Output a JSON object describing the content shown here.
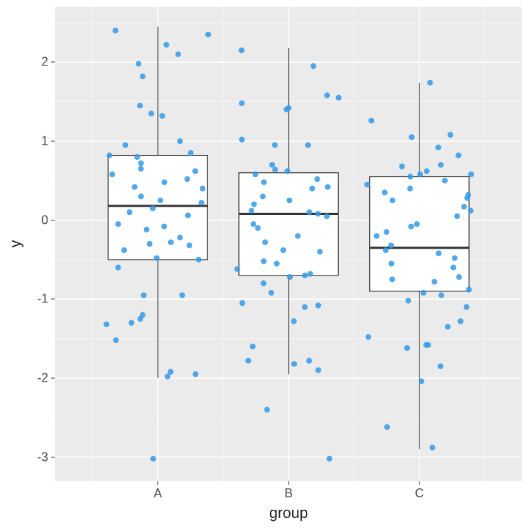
{
  "chart_data": {
    "type": "box-jitter",
    "xlabel": "group",
    "ylabel": "y",
    "categories": [
      "A",
      "B",
      "C"
    ],
    "ylim": [
      -3.3,
      2.7
    ],
    "y_ticks": [
      -3,
      -2,
      -1,
      0,
      1,
      2
    ],
    "point_color": "#3399E6",
    "panel_bg": "#EBEBEB",
    "series": [
      {
        "name": "A",
        "box": {
          "lower_whisker": -2.0,
          "q1": -0.5,
          "median": 0.18,
          "q3": 0.82,
          "upper_whisker": 2.45
        },
        "points": [
          1.82,
          1.45,
          -1.25,
          -1.98,
          -1.95,
          2.22,
          1.32,
          -0.95,
          -1.52,
          -1.92,
          0.72,
          -1.32,
          0.06,
          -0.05,
          -0.5,
          0.85,
          0.4,
          0.22,
          0.58,
          -0.28,
          0.95,
          2.4,
          1.35,
          0.82,
          -0.08,
          1.98,
          0.48,
          0.62,
          0.1,
          -0.12,
          -0.48,
          -0.32,
          -0.95,
          -0.6,
          0.25,
          0.15,
          0.3,
          -1.2,
          -1.3,
          -3.02,
          2.1,
          0.65,
          0.52,
          2.35,
          1.0,
          0.42,
          0.8,
          -0.3,
          -0.22,
          -0.38
        ]
      },
      {
        "name": "B",
        "box": {
          "lower_whisker": -1.95,
          "q1": -0.7,
          "median": 0.08,
          "q3": 0.6,
          "upper_whisker": 2.18
        },
        "points": [
          1.55,
          0.95,
          -0.62,
          -1.08,
          -1.28,
          1.95,
          1.02,
          -0.28,
          -0.72,
          0.58,
          0.3,
          0.48,
          -0.1,
          -0.7,
          0.1,
          -3.02,
          1.48,
          0.64,
          0.25,
          -0.05,
          -0.52,
          -0.8,
          -1.1,
          0.4,
          0.08,
          0.95,
          2.15,
          1.58,
          1.42,
          0.62,
          0.05,
          -0.4,
          -0.68,
          -1.05,
          -1.78,
          -1.6,
          -1.9,
          -2.4,
          1.4,
          0.52,
          0.2,
          -0.2,
          -0.55,
          -1.78,
          -1.82,
          0.12,
          0.7,
          -0.38,
          -0.92,
          0.42
        ]
      },
      {
        "name": "C",
        "box": {
          "lower_whisker": -2.9,
          "q1": -0.9,
          "median": -0.35,
          "q3": 0.55,
          "upper_whisker": 1.74
        },
        "points": [
          1.74,
          1.26,
          -0.42,
          -0.88,
          -0.75,
          -1.28,
          -1.58,
          -0.15,
          0.17,
          0.5,
          0.35,
          -2.04,
          -2.88,
          -2.62,
          0.58,
          0.32,
          -0.38,
          -0.6,
          -1.1,
          -1.85,
          0.68,
          1.05,
          0.82,
          0.55,
          0.45,
          -0.08,
          -0.92,
          -0.72,
          -1.35,
          -1.58,
          0.25,
          1.08,
          0.92,
          0.58,
          0.7,
          0.05,
          -0.32,
          -0.55,
          -0.95,
          -0.2,
          -0.78,
          -0.48,
          0.12,
          0.4,
          -1.02,
          -1.48,
          -1.62,
          -0.05,
          0.28,
          0.62
        ]
      }
    ]
  }
}
